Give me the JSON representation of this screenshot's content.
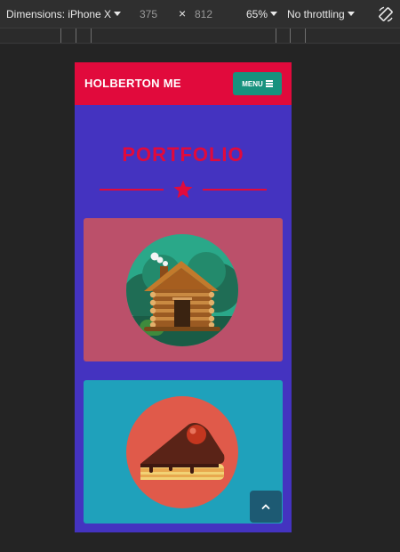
{
  "devtools": {
    "dimensions_label": "Dimensions: iPhone X",
    "width": "375",
    "times": "×",
    "height": "812",
    "zoom": "65%",
    "throttling": "No throttling",
    "icons": [
      "chevron-down-icon",
      "rotate-icon"
    ]
  },
  "site": {
    "brand": "HOLBERTON ME",
    "menu_label": "MENU",
    "section_title": "PORTFOLIO",
    "colors": {
      "navbar": "#e10a3c",
      "background": "#4433c0",
      "menu_button": "#17927e",
      "card_cabin": "#bb506a",
      "card_cake": "#1fa1bb",
      "back_to_top": "#1d5a73"
    },
    "portfolio": [
      {
        "image": "log-cabin-illustration",
        "color": "#bb506a"
      },
      {
        "image": "cake-slice-illustration",
        "color": "#1fa1bb"
      }
    ],
    "back_to_top_icon": "chevron-up-icon"
  }
}
